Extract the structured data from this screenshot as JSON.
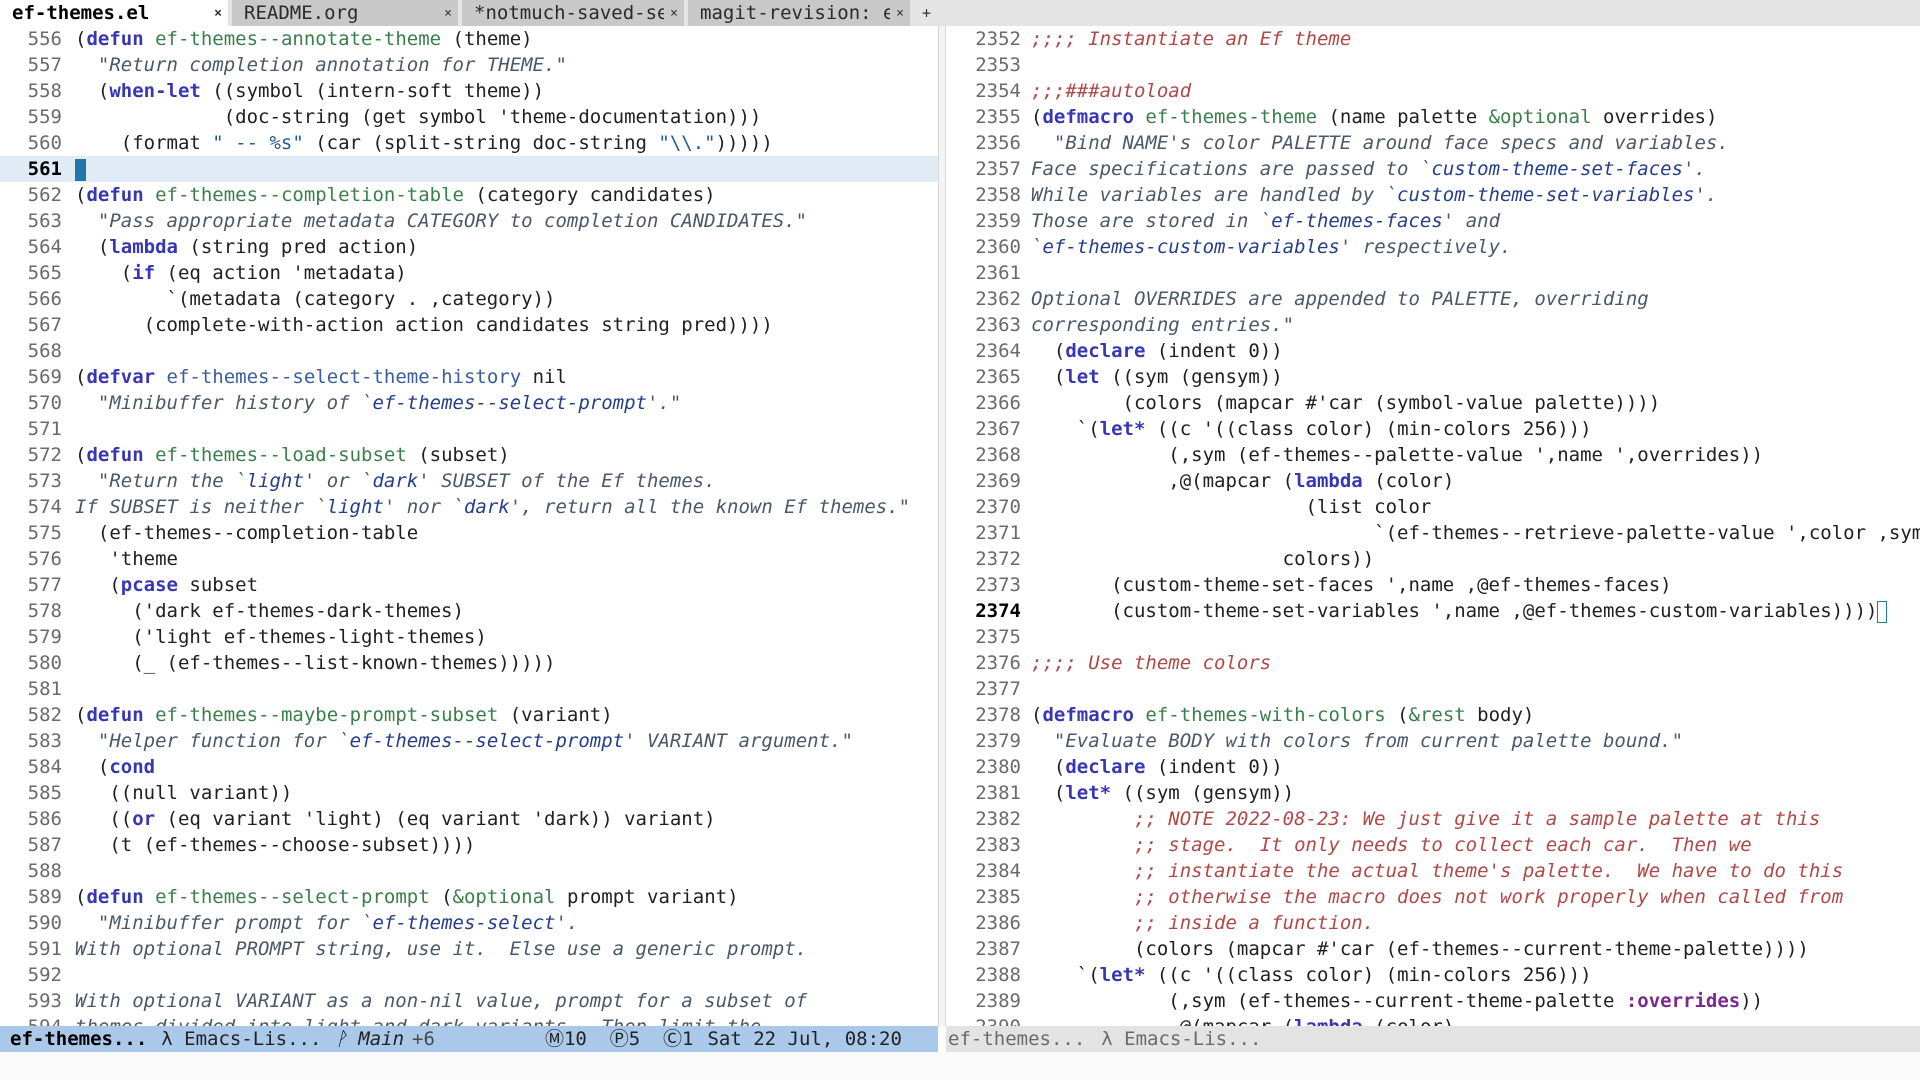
{
  "tabs": [
    {
      "label": "ef-themes.el",
      "active": true,
      "close": "×"
    },
    {
      "label": "README.org",
      "active": false,
      "close": "×"
    },
    {
      "label": "*notmuch-saved-sea",
      "active": false,
      "close": "×"
    },
    {
      "label": "magit-revision: ef",
      "active": false,
      "close": "×"
    }
  ],
  "new_tab_symbol": "+",
  "left_lines": [
    {
      "n": "556",
      "t": [
        [
          "kw-paren",
          "("
        ],
        [
          "kw",
          "defun"
        ],
        [
          "p",
          " "
        ],
        [
          "fn",
          "ef-themes--annotate-theme"
        ],
        [
          "p",
          " (theme)"
        ]
      ]
    },
    {
      "n": "557",
      "t": [
        [
          "p",
          "  "
        ],
        [
          "ds",
          "\"Return completion annotation for THEME.\""
        ]
      ]
    },
    {
      "n": "558",
      "t": [
        [
          "p",
          "  ("
        ],
        [
          "kw",
          "when-let"
        ],
        [
          "p",
          " ((symbol (intern-soft theme))"
        ]
      ]
    },
    {
      "n": "559",
      "t": [
        [
          "p",
          "             (doc-string (get symbol 'theme-documentation)))"
        ]
      ]
    },
    {
      "n": "560",
      "t": [
        [
          "p",
          "    (format "
        ],
        [
          "st",
          "\" -- %s\""
        ],
        [
          "p",
          " (car (split-string doc-string "
        ],
        [
          "st",
          "\"\\\\.\""
        ],
        [
          "p",
          ")))))"
        ]
      ]
    },
    {
      "n": "561",
      "t": [
        [
          "cursor",
          ""
        ]
      ],
      "current": true
    },
    {
      "n": "562",
      "t": [
        [
          "p",
          "("
        ],
        [
          "kw",
          "defun"
        ],
        [
          "p",
          " "
        ],
        [
          "fn",
          "ef-themes--completion-table"
        ],
        [
          "p",
          " (category candidates)"
        ]
      ]
    },
    {
      "n": "563",
      "t": [
        [
          "p",
          "  "
        ],
        [
          "ds",
          "\"Pass appropriate metadata CATEGORY to completion CANDIDATES.\""
        ]
      ]
    },
    {
      "n": "564",
      "t": [
        [
          "p",
          "  ("
        ],
        [
          "kw",
          "lambda"
        ],
        [
          "p",
          " (string pred action)"
        ]
      ]
    },
    {
      "n": "565",
      "t": [
        [
          "p",
          "    ("
        ],
        [
          "kw",
          "if"
        ],
        [
          "p",
          " (eq action 'metadata)"
        ]
      ]
    },
    {
      "n": "566",
      "t": [
        [
          "p",
          "        `(metadata (category . ,category))"
        ]
      ]
    },
    {
      "n": "567",
      "t": [
        [
          "p",
          "      (complete-with-action action candidates string pred))))"
        ]
      ]
    },
    {
      "n": "568",
      "t": []
    },
    {
      "n": "569",
      "t": [
        [
          "p",
          "("
        ],
        [
          "kw",
          "defvar"
        ],
        [
          "p",
          " "
        ],
        [
          "vr",
          "ef-themes--select-theme-history"
        ],
        [
          "p",
          " nil"
        ]
      ]
    },
    {
      "n": "570",
      "t": [
        [
          "p",
          "  "
        ],
        [
          "ds",
          "\"Minibuffer history of `"
        ],
        [
          "dsr",
          "ef-themes--select-prompt"
        ],
        [
          "ds",
          "'.\""
        ]
      ]
    },
    {
      "n": "571",
      "t": []
    },
    {
      "n": "572",
      "t": [
        [
          "p",
          "("
        ],
        [
          "kw",
          "defun"
        ],
        [
          "p",
          " "
        ],
        [
          "fn",
          "ef-themes--load-subset"
        ],
        [
          "p",
          " (subset)"
        ]
      ]
    },
    {
      "n": "573",
      "t": [
        [
          "p",
          "  "
        ],
        [
          "ds",
          "\"Return the `"
        ],
        [
          "dsr",
          "light"
        ],
        [
          "ds",
          "' or `"
        ],
        [
          "dsr",
          "dark"
        ],
        [
          "ds",
          "' SUBSET of the Ef themes."
        ]
      ]
    },
    {
      "n": "574",
      "t": [
        [
          "ds",
          "If SUBSET is neither `"
        ],
        [
          "dsr",
          "light"
        ],
        [
          "ds",
          "' nor `"
        ],
        [
          "dsr",
          "dark"
        ],
        [
          "ds",
          "', return all the known Ef themes.\""
        ]
      ]
    },
    {
      "n": "575",
      "t": [
        [
          "p",
          "  (ef-themes--completion-table"
        ]
      ]
    },
    {
      "n": "576",
      "t": [
        [
          "p",
          "   'theme"
        ]
      ]
    },
    {
      "n": "577",
      "t": [
        [
          "p",
          "   ("
        ],
        [
          "kw",
          "pcase"
        ],
        [
          "p",
          " subset"
        ]
      ]
    },
    {
      "n": "578",
      "t": [
        [
          "p",
          "     ('dark ef-themes-dark-themes)"
        ]
      ]
    },
    {
      "n": "579",
      "t": [
        [
          "p",
          "     ('light ef-themes-light-themes)"
        ]
      ]
    },
    {
      "n": "580",
      "t": [
        [
          "p",
          "     (_ (ef-themes--list-known-themes)))))"
        ]
      ]
    },
    {
      "n": "581",
      "t": []
    },
    {
      "n": "582",
      "t": [
        [
          "p",
          "("
        ],
        [
          "kw",
          "defun"
        ],
        [
          "p",
          " "
        ],
        [
          "fn",
          "ef-themes--maybe-prompt-subset"
        ],
        [
          "p",
          " (variant)"
        ]
      ]
    },
    {
      "n": "583",
      "t": [
        [
          "p",
          "  "
        ],
        [
          "ds",
          "\"Helper function for `"
        ],
        [
          "dsr",
          "ef-themes--select-prompt"
        ],
        [
          "ds",
          "' VARIANT argument.\""
        ]
      ]
    },
    {
      "n": "584",
      "t": [
        [
          "p",
          "  ("
        ],
        [
          "kw",
          "cond"
        ]
      ]
    },
    {
      "n": "585",
      "t": [
        [
          "p",
          "   ((null variant))"
        ]
      ]
    },
    {
      "n": "586",
      "t": [
        [
          "p",
          "   (("
        ],
        [
          "kw",
          "or"
        ],
        [
          "p",
          " (eq variant 'light) (eq variant 'dark)) variant)"
        ]
      ]
    },
    {
      "n": "587",
      "t": [
        [
          "p",
          "   (t (ef-themes--choose-subset))))"
        ]
      ]
    },
    {
      "n": "588",
      "t": []
    },
    {
      "n": "589",
      "t": [
        [
          "p",
          "("
        ],
        [
          "kw",
          "defun"
        ],
        [
          "p",
          " "
        ],
        [
          "fn",
          "ef-themes--select-prompt"
        ],
        [
          "p",
          " ("
        ],
        [
          "opt",
          "&optional"
        ],
        [
          "p",
          " prompt variant)"
        ]
      ]
    },
    {
      "n": "590",
      "t": [
        [
          "p",
          "  "
        ],
        [
          "ds",
          "\"Minibuffer prompt for `"
        ],
        [
          "dsr",
          "ef-themes-select"
        ],
        [
          "ds",
          "'."
        ]
      ]
    },
    {
      "n": "591",
      "t": [
        [
          "ds",
          "With optional PROMPT string, use it.  Else use a generic prompt."
        ]
      ]
    },
    {
      "n": "592",
      "t": []
    },
    {
      "n": "593",
      "t": [
        [
          "ds",
          "With optional VARIANT as a non-nil value, prompt for a subset of"
        ]
      ]
    },
    {
      "n": "594",
      "t": [
        [
          "ds",
          "themes divided into light and dark variants.  Then limit the"
        ]
      ]
    }
  ],
  "right_lines": [
    {
      "n": "2352",
      "t": [
        [
          "cm",
          ";;;; Instantiate an Ef theme"
        ]
      ]
    },
    {
      "n": "2353",
      "t": []
    },
    {
      "n": "2354",
      "t": [
        [
          "cm",
          ";;;###autoload"
        ]
      ]
    },
    {
      "n": "2355",
      "t": [
        [
          "p",
          "("
        ],
        [
          "kw",
          "defmacro"
        ],
        [
          "p",
          " "
        ],
        [
          "fn",
          "ef-themes-theme"
        ],
        [
          "p",
          " (name palette "
        ],
        [
          "opt",
          "&optional"
        ],
        [
          "p",
          " overrides)"
        ]
      ]
    },
    {
      "n": "2356",
      "t": [
        [
          "p",
          "  "
        ],
        [
          "ds",
          "\"Bind NAME's color PALETTE around face specs and variables."
        ]
      ]
    },
    {
      "n": "2357",
      "t": [
        [
          "ds",
          "Face specifications are passed to `"
        ],
        [
          "dsr",
          "custom-theme-set-faces"
        ],
        [
          "ds",
          "'."
        ]
      ]
    },
    {
      "n": "2358",
      "t": [
        [
          "ds",
          "While variables are handled by `"
        ],
        [
          "dsr",
          "custom-theme-set-variables"
        ],
        [
          "ds",
          "'."
        ]
      ]
    },
    {
      "n": "2359",
      "t": [
        [
          "ds",
          "Those are stored in `"
        ],
        [
          "dsr",
          "ef-themes-faces"
        ],
        [
          "ds",
          "' and"
        ]
      ]
    },
    {
      "n": "2360",
      "t": [
        [
          "ds",
          "`"
        ],
        [
          "dsr",
          "ef-themes-custom-variables"
        ],
        [
          "ds",
          "' respectively."
        ]
      ]
    },
    {
      "n": "2361",
      "t": []
    },
    {
      "n": "2362",
      "t": [
        [
          "ds",
          "Optional OVERRIDES are appended to PALETTE, overriding"
        ]
      ]
    },
    {
      "n": "2363",
      "t": [
        [
          "ds",
          "corresponding entries.\""
        ]
      ]
    },
    {
      "n": "2364",
      "t": [
        [
          "p",
          "  ("
        ],
        [
          "kw",
          "declare"
        ],
        [
          "p",
          " (indent 0))"
        ]
      ]
    },
    {
      "n": "2365",
      "t": [
        [
          "p",
          "  ("
        ],
        [
          "kw",
          "let"
        ],
        [
          "p",
          " ((sym (gensym))"
        ]
      ]
    },
    {
      "n": "2366",
      "t": [
        [
          "p",
          "        (colors (mapcar #'car (symbol-value palette))))"
        ]
      ]
    },
    {
      "n": "2367",
      "t": [
        [
          "p",
          "    `("
        ],
        [
          "kw",
          "let*"
        ],
        [
          "p",
          " ((c '((class color) (min-colors 256)))"
        ]
      ]
    },
    {
      "n": "2368",
      "t": [
        [
          "p",
          "            (,sym (ef-themes--palette-value ',name ',overrides))"
        ]
      ]
    },
    {
      "n": "2369",
      "t": [
        [
          "p",
          "            ,@(mapcar ("
        ],
        [
          "kw",
          "lambda"
        ],
        [
          "p",
          " (color)"
        ]
      ]
    },
    {
      "n": "2370",
      "t": [
        [
          "p",
          "                        (list color"
        ]
      ]
    },
    {
      "n": "2371",
      "t": [
        [
          "p",
          "                              `(ef-themes--retrieve-palette-value ',color ,sym)))"
        ]
      ]
    },
    {
      "n": "2372",
      "t": [
        [
          "p",
          "                      colors))"
        ]
      ]
    },
    {
      "n": "2373",
      "t": [
        [
          "p",
          "       (custom-theme-set-faces ',name ,@ef-themes-faces)"
        ]
      ]
    },
    {
      "n": "2374",
      "t": [
        [
          "p",
          "       (custom-theme-set-variables ',name ,@ef-themes-custom-variables))))"
        ],
        [
          "cursor-outline",
          ""
        ]
      ],
      "current": true
    },
    {
      "n": "2375",
      "t": []
    },
    {
      "n": "2376",
      "t": [
        [
          "cm",
          ";;;; Use theme colors"
        ]
      ]
    },
    {
      "n": "2377",
      "t": []
    },
    {
      "n": "2378",
      "t": [
        [
          "p",
          "("
        ],
        [
          "kw",
          "defmacro"
        ],
        [
          "p",
          " "
        ],
        [
          "fn",
          "ef-themes-with-colors"
        ],
        [
          "p",
          " ("
        ],
        [
          "opt",
          "&rest"
        ],
        [
          "p",
          " body)"
        ]
      ]
    },
    {
      "n": "2379",
      "t": [
        [
          "p",
          "  "
        ],
        [
          "ds",
          "\"Evaluate BODY with colors from current palette bound.\""
        ]
      ]
    },
    {
      "n": "2380",
      "t": [
        [
          "p",
          "  ("
        ],
        [
          "kw",
          "declare"
        ],
        [
          "p",
          " (indent 0))"
        ]
      ]
    },
    {
      "n": "2381",
      "t": [
        [
          "p",
          "  ("
        ],
        [
          "kw",
          "let*"
        ],
        [
          "p",
          " ((sym (gensym))"
        ]
      ]
    },
    {
      "n": "2382",
      "t": [
        [
          "p",
          "         "
        ],
        [
          "cm",
          ";; NOTE 2022-08-23: We just give it a sample palette at this"
        ]
      ]
    },
    {
      "n": "2383",
      "t": [
        [
          "p",
          "         "
        ],
        [
          "cm",
          ";; stage.  It only needs to collect each car.  Then we"
        ]
      ]
    },
    {
      "n": "2384",
      "t": [
        [
          "p",
          "         "
        ],
        [
          "cm",
          ";; instantiate the actual theme's palette.  We have to do this"
        ]
      ]
    },
    {
      "n": "2385",
      "t": [
        [
          "p",
          "         "
        ],
        [
          "cm",
          ";; otherwise the macro does not work properly when called from"
        ]
      ]
    },
    {
      "n": "2386",
      "t": [
        [
          "p",
          "         "
        ],
        [
          "cm",
          ";; inside a function."
        ]
      ]
    },
    {
      "n": "2387",
      "t": [
        [
          "p",
          "         (colors (mapcar #'car (ef-themes--current-theme-palette))))"
        ]
      ]
    },
    {
      "n": "2388",
      "t": [
        [
          "p",
          "    `("
        ],
        [
          "kw",
          "let*"
        ],
        [
          "p",
          " ((c '((class color) (min-colors 256)))"
        ]
      ]
    },
    {
      "n": "2389",
      "t": [
        [
          "p",
          "            (,sym (ef-themes--current-theme-palette "
        ],
        [
          "kwd",
          ":overrides"
        ],
        [
          "p",
          "))"
        ]
      ]
    },
    {
      "n": "2390",
      "t": [
        [
          "p",
          "            ,@(mapcar ("
        ],
        [
          "kw",
          "lambda"
        ],
        [
          "p",
          " (color)"
        ]
      ]
    }
  ],
  "modeline_left": {
    "buffer": "ef-themes...",
    "mode": "λ Emacs-Lis...",
    "branch": "ᚹ Main",
    "changes": "+6",
    "counters": "Ⓜ10  Ⓟ5  Ⓒ1",
    "datetime": "Sat 22 Jul, 08:20"
  },
  "modeline_right": {
    "buffer": "ef-themes...",
    "mode": "λ Emacs-Lis..."
  },
  "colors": {
    "modeline_active": "#aac8ea",
    "modeline_inactive": "#e3e3e3",
    "current_line": "#e1ebf6",
    "cursor": "#2277aa"
  }
}
